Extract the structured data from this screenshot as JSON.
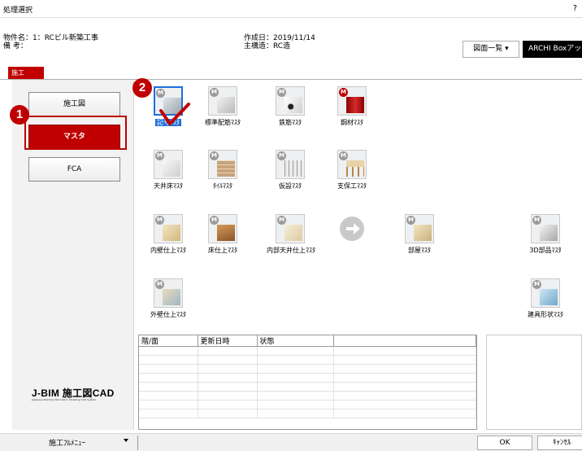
{
  "window": {
    "title": "処理選択",
    "help": "?"
  },
  "header": {
    "project_name": "物件名：1：RCビル新築工事",
    "remarks": "備 考：",
    "created": "作成日：2019/11/14",
    "structure": "主構造：RC造",
    "drawing_list": "図面一覧 ▾",
    "archi_box": "ARCHI Boxアップ"
  },
  "tab": {
    "label": "施工"
  },
  "side_menu": [
    {
      "label": "施工図",
      "active": false
    },
    {
      "label": "マスタ",
      "active": true
    },
    {
      "label": "FCA",
      "active": false
    }
  ],
  "callouts": {
    "one": "1",
    "two": "2"
  },
  "masters": [
    {
      "label": "記号ﾏｽﾀ",
      "icon": "symbol-master-icon",
      "selected": true
    },
    {
      "label": "標準配筋ﾏｽﾀ",
      "icon": "rebar-standard-icon",
      "selected": false
    },
    {
      "label": "鉄筋ﾏｽﾀ",
      "icon": "rebar-icon",
      "selected": false
    },
    {
      "label": "鋼材ﾏｽﾀ",
      "icon": "steel-icon",
      "selected": false
    },
    {
      "label": "天井床ﾏｽﾀ",
      "icon": "ceiling-floor-icon",
      "selected": false
    },
    {
      "label": "ﾀｲﾙﾏｽﾀ",
      "icon": "tile-icon",
      "selected": false
    },
    {
      "label": "仮設ﾏｽﾀ",
      "icon": "temporary-icon",
      "selected": false
    },
    {
      "label": "支保工ﾏｽﾀ",
      "icon": "shoring-icon",
      "selected": false
    },
    {
      "label": "内壁仕上ﾏｽﾀ",
      "icon": "inner-wall-icon",
      "selected": false
    },
    {
      "label": "床仕上ﾏｽﾀ",
      "icon": "floor-finish-icon",
      "selected": false
    },
    {
      "label": "内部天井仕上ﾏｽﾀ",
      "icon": "ceiling-finish-icon",
      "selected": false
    },
    {
      "label": "",
      "icon": "arrow-right-icon",
      "selected": false
    },
    {
      "label": "部屋ﾏｽﾀ",
      "icon": "room-icon",
      "selected": false
    },
    {
      "label": "3D部品ﾏｽﾀ",
      "icon": "3d-parts-icon",
      "selected": false
    },
    {
      "label": "外壁仕上ﾏｽﾀ",
      "icon": "outer-wall-icon",
      "selected": false
    },
    {
      "label": "建具形状ﾏｽﾀ",
      "icon": "fitting-icon",
      "selected": false
    }
  ],
  "table": {
    "columns": [
      "階/面",
      "更新日時",
      "状態",
      ""
    ],
    "rows": [
      [
        "",
        "",
        "",
        ""
      ],
      [
        "",
        "",
        "",
        ""
      ],
      [
        "",
        "",
        "",
        ""
      ],
      [
        "",
        "",
        "",
        ""
      ],
      [
        "",
        "",
        "",
        ""
      ],
      [
        "",
        "",
        "",
        ""
      ],
      [
        "",
        "",
        "",
        ""
      ],
      [
        "",
        "",
        "",
        ""
      ]
    ]
  },
  "logo": {
    "text": "J-BIM 施工図CAD",
    "subtitle": "Japanese Building Information Modeling CAD System"
  },
  "footer": {
    "menu": "施工ﾌﾙﾒﾆｭｰ",
    "ok": "OK",
    "cancel": "ｷｬﾝｾﾙ"
  },
  "colors": {
    "accent": "#c00000",
    "selection": "#1e6fd9"
  }
}
